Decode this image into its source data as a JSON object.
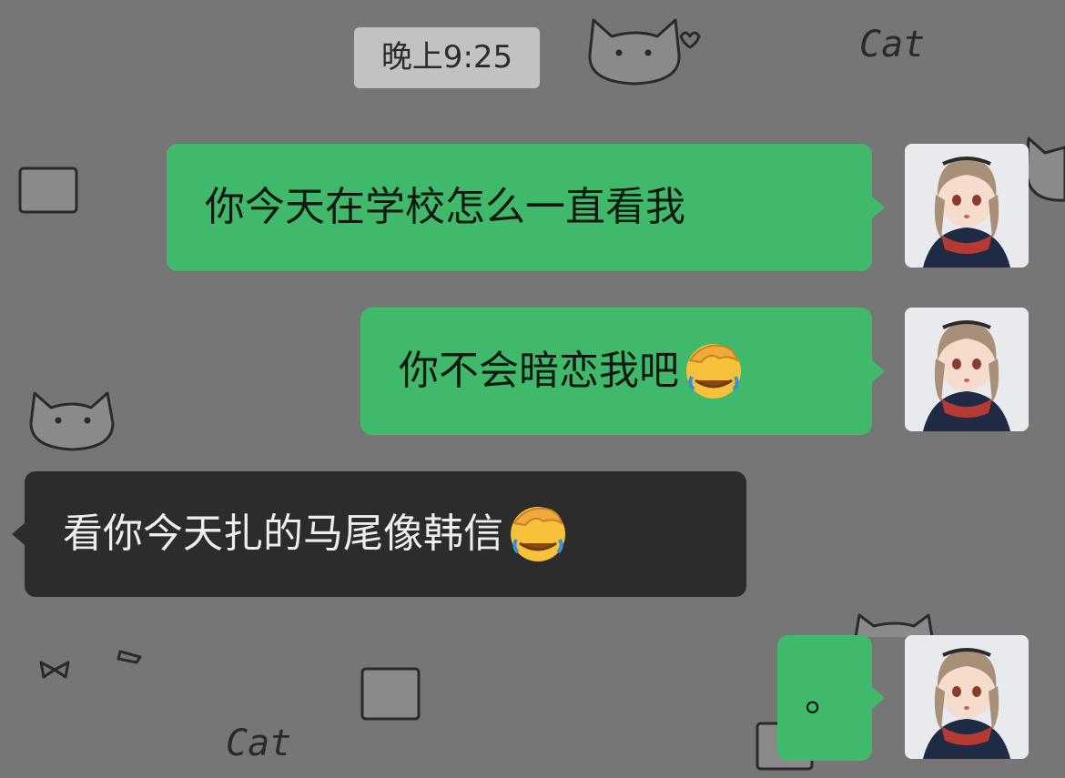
{
  "chat": {
    "timestamp": "晚上9:25",
    "messages": [
      {
        "direction": "outgoing",
        "text": "你今天在学校怎么一直看我",
        "emoji": null
      },
      {
        "direction": "outgoing",
        "text": "你不会暗恋我吧",
        "emoji": "facepalm-emoji"
      },
      {
        "direction": "incoming",
        "text": "看你今天扎的马尾像韩信",
        "emoji": "facepalm-emoji"
      },
      {
        "direction": "outgoing",
        "text": "。",
        "emoji": null
      }
    ]
  },
  "wallpaper": {
    "doodle_texts": [
      "Cat",
      "Cat"
    ]
  },
  "colors": {
    "outgoing_bubble": "#41b96b",
    "incoming_bubble": "#2c2c2c",
    "background": "#767676",
    "timestamp_pill": "#c2c2c2"
  }
}
